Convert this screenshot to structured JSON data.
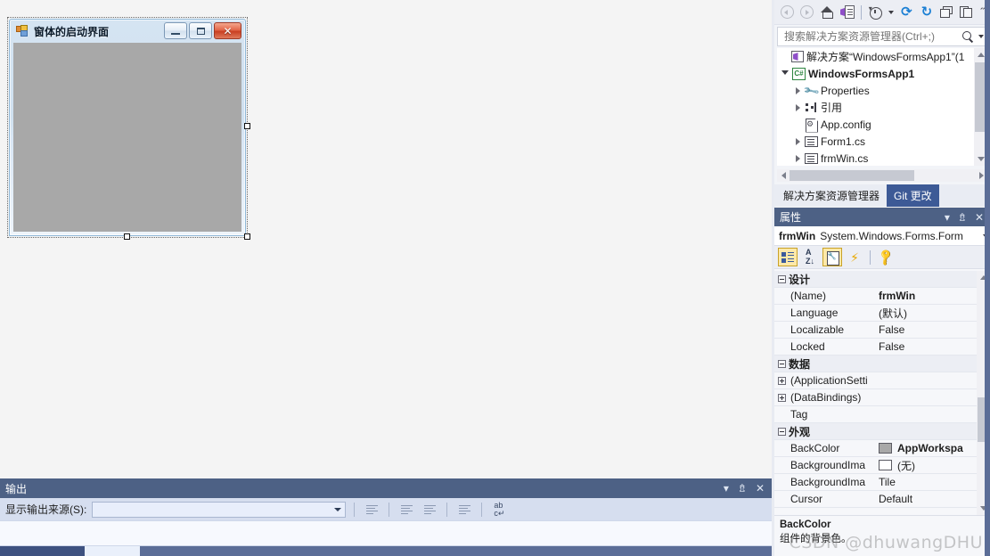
{
  "designer": {
    "form": {
      "title": "窗体的启动界面",
      "icon": "form-icon",
      "buttons": [
        {
          "name": "minimize-button",
          "glyph": "minimize-icon"
        },
        {
          "name": "maximize-button",
          "glyph": "maximize-icon"
        },
        {
          "name": "close-button",
          "glyph": "close-icon",
          "label": "✕"
        }
      ],
      "client_background": "#a8a8a8"
    }
  },
  "output": {
    "title": "输出",
    "header_icons": [
      "chevron-down-icon",
      "pin-icon",
      "close-icon"
    ],
    "source_label": "显示输出来源(S):",
    "source_value": "",
    "source_placeholder": "",
    "toolbar_icons": [
      "find-message-icon",
      "go-to-previous-icon",
      "go-to-next-icon",
      "clear-all-icon",
      "toggle-word-wrap-icon"
    ]
  },
  "solution_explorer": {
    "toolbar_icons": [
      "back-icon",
      "forward-icon",
      "home-icon",
      "sync-with-active-document-icon",
      "pending-changes-filter-icon",
      "chevron-down-icon",
      "refresh-icon",
      "sync-icon",
      "collapse-all-icon",
      "show-all-files-icon",
      "overflow-icon"
    ],
    "search_placeholder": "搜索解决方案资源管理器(Ctrl+;)",
    "search_value": "",
    "tree": [
      {
        "label": "解决方案“WindowsFormsApp1”(1",
        "icon": "solution-icon",
        "indent": 0,
        "expander": "none",
        "bold": false
      },
      {
        "label": "WindowsFormsApp1",
        "icon": "csharp-project-icon",
        "indent": 1,
        "expander": "open",
        "bold": true
      },
      {
        "label": "Properties",
        "icon": "wrench-icon",
        "indent": 2,
        "expander": "closed",
        "bold": false
      },
      {
        "label": "引用",
        "icon": "references-icon",
        "indent": 2,
        "expander": "closed",
        "bold": false
      },
      {
        "label": "App.config",
        "icon": "config-file-icon",
        "indent": 2,
        "expander": "none",
        "bold": false
      },
      {
        "label": "Form1.cs",
        "icon": "form-file-icon",
        "indent": 2,
        "expander": "closed",
        "bold": false
      },
      {
        "label": "frmWin.cs",
        "icon": "form-file-icon",
        "indent": 2,
        "expander": "closed",
        "bold": false
      }
    ],
    "tabs": [
      {
        "label": "解决方案资源管理器",
        "active": true
      },
      {
        "label": "Git 更改",
        "active": false
      }
    ]
  },
  "properties": {
    "title": "属性",
    "header_icons": [
      "chevron-down-icon",
      "pin-icon",
      "close-icon"
    ],
    "object_name": "frmWin",
    "object_type": "System.Windows.Forms.Form",
    "toolbar_icons": [
      "categorized-icon",
      "alphabetical-icon",
      "properties-page-icon",
      "events-icon",
      "property-pages-icon"
    ],
    "rows": [
      {
        "type": "category",
        "expander": "minus",
        "name": "设计"
      },
      {
        "type": "prop",
        "expander": "none",
        "name": "(Name)",
        "value": "frmWin",
        "bold": true
      },
      {
        "type": "prop",
        "expander": "none",
        "name": "Language",
        "value": "(默认)",
        "bold": false
      },
      {
        "type": "prop",
        "expander": "none",
        "name": "Localizable",
        "value": "False",
        "bold": false
      },
      {
        "type": "prop",
        "expander": "none",
        "name": "Locked",
        "value": "False",
        "bold": false
      },
      {
        "type": "category",
        "expander": "minus",
        "name": "数据"
      },
      {
        "type": "prop",
        "expander": "plus",
        "name": "(ApplicationSetti",
        "value": "",
        "bold": false
      },
      {
        "type": "prop",
        "expander": "plus",
        "name": "(DataBindings)",
        "value": "",
        "bold": false
      },
      {
        "type": "prop",
        "expander": "none",
        "name": "Tag",
        "value": "",
        "bold": false
      },
      {
        "type": "category",
        "expander": "minus",
        "name": "外观"
      },
      {
        "type": "prop",
        "expander": "none",
        "name": "BackColor",
        "value": "AppWorkspa",
        "bold": true,
        "swatch": "#a8a8a8"
      },
      {
        "type": "prop",
        "expander": "none",
        "name": "BackgroundIma",
        "value": "(无)",
        "bold": false,
        "swatch": "#ffffff"
      },
      {
        "type": "prop",
        "expander": "none",
        "name": "BackgroundIma",
        "value": "Tile",
        "bold": false
      },
      {
        "type": "prop",
        "expander": "none",
        "name": "Cursor",
        "value": "Default",
        "bold": false
      }
    ],
    "description": {
      "title": "BackColor",
      "text": "组件的背景色。"
    }
  },
  "watermark": "CSDN @dhuwangDHU",
  "colors": {
    "panel_header": "#4d6185",
    "accent_blue": "#1a7fd4",
    "git_tab": "#3d5a96",
    "form_client": "#a8a8a8",
    "designer_bg": "#f4f4f4"
  }
}
